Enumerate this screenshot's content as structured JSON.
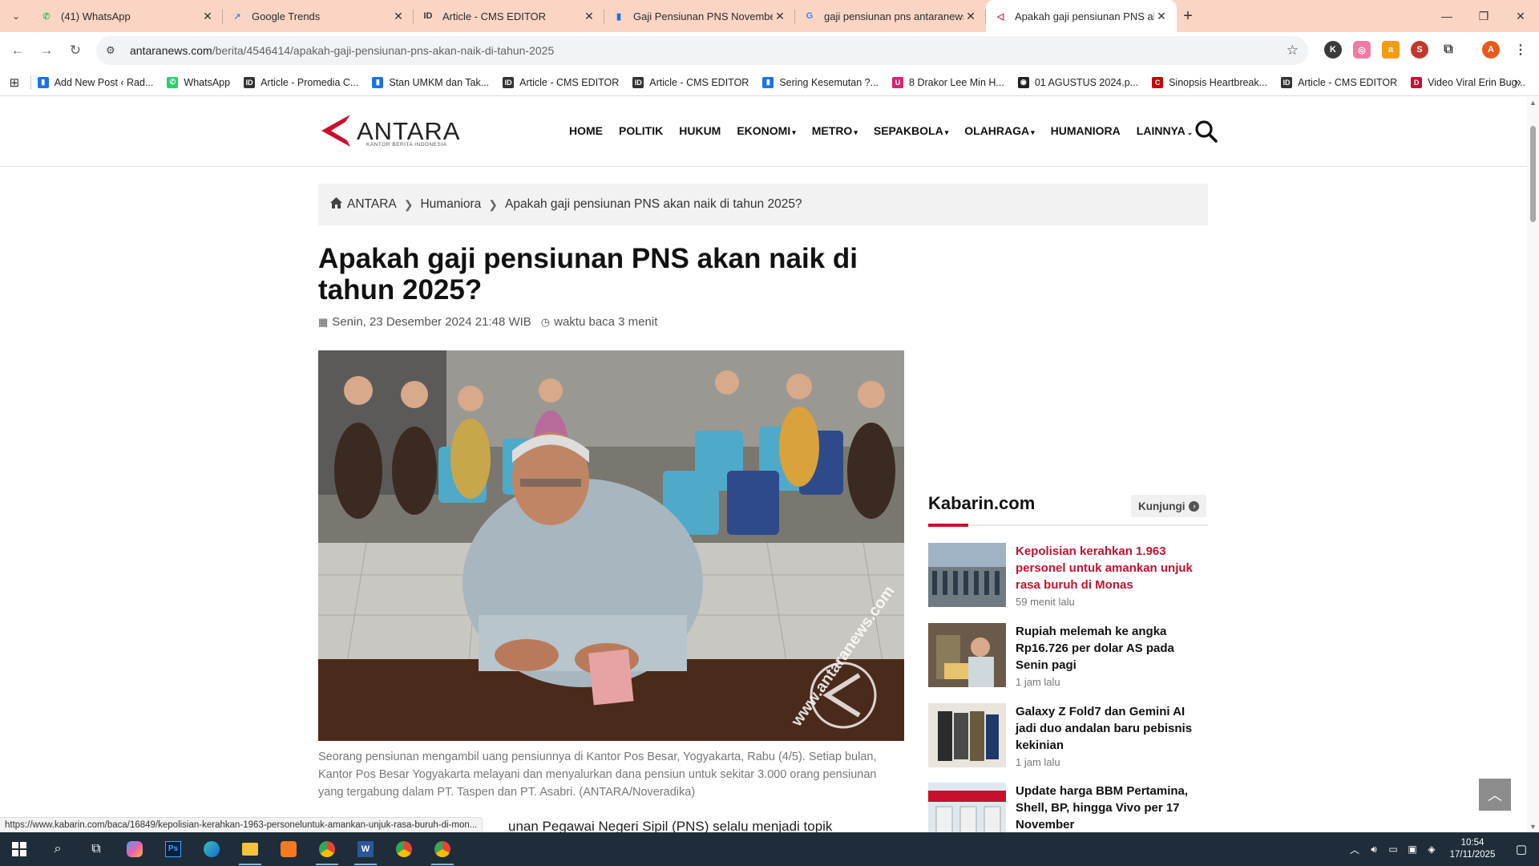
{
  "browser": {
    "tabs": [
      {
        "title": "(41) WhatsApp",
        "icon": "whatsapp-icon",
        "color": "#25d366",
        "glyph": "✆"
      },
      {
        "title": "Google Trends",
        "icon": "trends-icon",
        "color": "#4285f4",
        "glyph": "↗"
      },
      {
        "title": "Article - CMS EDITOR",
        "icon": "cms-icon",
        "color": "#333333",
        "glyph": "ID"
      },
      {
        "title": "Gaji Pensiunan PNS November",
        "icon": "doc-icon",
        "color": "#1a73e8",
        "glyph": "▮"
      },
      {
        "title": "gaji pensiunan pns antaranews",
        "icon": "google-icon",
        "color": "#4285f4",
        "glyph": "G"
      },
      {
        "title": "Apakah gaji pensiunan PNS akan",
        "icon": "antara-icon",
        "color": "#c8102e",
        "glyph": "◁"
      }
    ],
    "url_host": "antaranews.com",
    "url_path": "/berita/4546414/apakah-gaji-pensiunan-pns-akan-naik-di-tahun-2025",
    "bookmarks": [
      {
        "label": "Add New Post ‹ Rad...",
        "color": "#1a73e8",
        "glyph": "▮"
      },
      {
        "label": "WhatsApp",
        "color": "#25d366",
        "glyph": "✆"
      },
      {
        "label": "Article - Promedia C...",
        "color": "#333333",
        "glyph": "ID"
      },
      {
        "label": "Stan UMKM dan Tak...",
        "color": "#1a73e8",
        "glyph": "▮"
      },
      {
        "label": "Article - CMS EDITOR",
        "color": "#333333",
        "glyph": "ID"
      },
      {
        "label": "Article - CMS EDITOR",
        "color": "#333333",
        "glyph": "ID"
      },
      {
        "label": "Sering Kesemutan ?...",
        "color": "#1a73e8",
        "glyph": "▮"
      },
      {
        "label": "8 Drakor Lee Min H...",
        "color": "#d6246e",
        "glyph": "U"
      },
      {
        "label": "01 AGUSTUS 2024.p...",
        "color": "#222222",
        "glyph": "◉"
      },
      {
        "label": "Sinopsis Heartbreak...",
        "color": "#cc0000",
        "glyph": "C"
      },
      {
        "label": "Article - CMS EDITOR",
        "color": "#333333",
        "glyph": "ID"
      },
      {
        "label": "Video Viral Erin Bug...",
        "color": "#c8102e",
        "glyph": "D"
      }
    ],
    "status_url": "https://www.kabarin.com/baca/16849/kepolisian-kerahkan-1963-personeluntuk-amankan-unjuk-rasa-buruh-di-mon..."
  },
  "site": {
    "logo_text": "ANTARA",
    "logo_tagline": "KANTOR BERITA INDONESIA",
    "nav": [
      {
        "label": "HOME",
        "dropdown": false
      },
      {
        "label": "POLITIK",
        "dropdown": false
      },
      {
        "label": "HUKUM",
        "dropdown": false
      },
      {
        "label": "EKONOMI",
        "dropdown": true
      },
      {
        "label": "METRO",
        "dropdown": true
      },
      {
        "label": "SEPAKBOLA",
        "dropdown": true
      },
      {
        "label": "OLAHRAGA",
        "dropdown": true
      },
      {
        "label": "HUMANIORA",
        "dropdown": false
      },
      {
        "label": "LAINNYA",
        "dropdown": true
      }
    ],
    "accent_color": "#c8102e"
  },
  "breadcrumb": [
    "ANTARA",
    "Humaniora",
    "Apakah gaji pensiunan PNS akan naik di tahun 2025?"
  ],
  "article": {
    "title": "Apakah gaji pensiunan PNS akan naik di tahun 2025?",
    "date": "Senin, 23 Desember 2024 21:48 WIB",
    "read_time": "waktu baca 3 menit",
    "photo_watermark": "www.antaranews.com",
    "caption": "Seorang pensiunan mengambil uang pensiunnya di Kantor Pos Besar, Yogyakarta, Rabu (4/5). Setiap bulan, Kantor Pos Besar Yogyakarta melayani dan menyalurkan dana pensiun untuk sekitar 3.000 orang pensiunan yang tergabung dalam PT. Taspen dan PT. Asabri. (ANTARA/Noveradika)",
    "body_partial": "unan Pegawai Negeri Sipil (PNS) selalu menjadi topik"
  },
  "sidebar": {
    "widget_title": "Kabarin.com",
    "visit_label": "Kunjungi",
    "news": [
      {
        "headline": "Kepolisian kerahkan 1.963 personel untuk amankan unjuk rasa buruh di Monas",
        "time": "59 menit lalu",
        "highlight": true
      },
      {
        "headline": "Rupiah melemah ke angka Rp16.726 per dolar AS pada Senin pagi",
        "time": "1 jam lalu",
        "highlight": false
      },
      {
        "headline": "Galaxy Z Fold7 dan Gemini AI jadi duo andalan baru pebisnis kekinian",
        "time": "1 jam lalu",
        "highlight": false
      },
      {
        "headline": "Update harga BBM Pertamina, Shell, BP, hingga Vivo per 17 November",
        "time": "",
        "highlight": false
      }
    ]
  },
  "taskbar": {
    "time": "10:54",
    "date": "17/11/2025"
  }
}
